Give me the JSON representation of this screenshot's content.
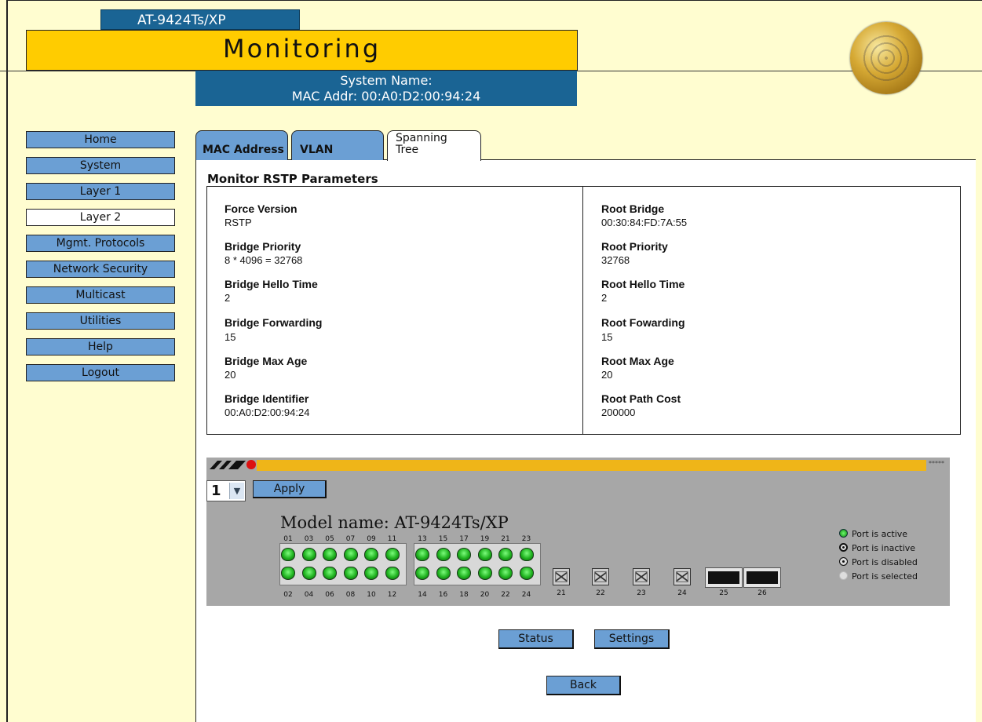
{
  "header": {
    "model_tab": "AT-9424Ts/XP",
    "title": "Monitoring",
    "system_name_line": "System Name:",
    "mac_line": "MAC Addr: 00:A0:D2:00:94:24"
  },
  "sidebar": {
    "items": [
      {
        "label": "Home"
      },
      {
        "label": "System"
      },
      {
        "label": "Layer 1"
      },
      {
        "label": "Layer 2"
      },
      {
        "label": "Mgmt. Protocols"
      },
      {
        "label": "Network Security"
      },
      {
        "label": "Multicast"
      },
      {
        "label": "Utilities"
      },
      {
        "label": "Help"
      },
      {
        "label": "Logout"
      }
    ],
    "active": "Layer 2"
  },
  "tabs": {
    "mac": "MAC Address",
    "vlan": "VLAN",
    "stp_line1": "Spanning",
    "stp_line2": "Tree"
  },
  "panel": {
    "title": "Monitor RSTP Parameters",
    "left": [
      {
        "label": "Force Version",
        "value": "RSTP"
      },
      {
        "label": "Bridge Priority",
        "value": "8 * 4096 = 32768"
      },
      {
        "label": "Bridge Hello Time",
        "value": "2"
      },
      {
        "label": "Bridge Forwarding",
        "value": "15"
      },
      {
        "label": "Bridge Max Age",
        "value": "20"
      },
      {
        "label": "Bridge Identifier",
        "value": "00:A0:D2:00:94:24"
      }
    ],
    "right": [
      {
        "label": "Root Bridge",
        "value": "00:30:84:FD:7A:55"
      },
      {
        "label": "Root Priority",
        "value": "32768"
      },
      {
        "label": "Root Hello Time",
        "value": "2"
      },
      {
        "label": "Root Fowarding",
        "value": "15"
      },
      {
        "label": "Root Max Age",
        "value": "20"
      },
      {
        "label": "Root Path Cost",
        "value": "200000"
      }
    ]
  },
  "switch": {
    "stack_select": "1",
    "apply_label": "Apply",
    "model_name": "Model name: AT-9424Ts/XP",
    "stars": "*****",
    "top_ports_a": [
      "01",
      "03",
      "05",
      "07",
      "09",
      "11"
    ],
    "top_ports_b": [
      "13",
      "15",
      "17",
      "19",
      "21",
      "23"
    ],
    "bottom_ports_a": [
      "02",
      "04",
      "06",
      "08",
      "10",
      "12"
    ],
    "bottom_ports_b": [
      "14",
      "16",
      "18",
      "20",
      "22",
      "24"
    ],
    "sfp_ports": [
      "21",
      "22",
      "23",
      "24"
    ],
    "xfp_ports": [
      "25",
      "26"
    ],
    "legend": {
      "active": "Port is active",
      "inactive": "Port is inactive",
      "disabled": "Port is disabled",
      "selected": "Port is selected"
    }
  },
  "buttons": {
    "status": "Status",
    "settings": "Settings",
    "back": "Back"
  },
  "colors": {
    "nav_blue": "#6b9fd4",
    "header_blue": "#1a6494",
    "title_yellow": "#ffcc00",
    "page_bg": "#fffdd0",
    "switch_gray": "#a7a7a7",
    "switch_bar": "#efb518"
  }
}
